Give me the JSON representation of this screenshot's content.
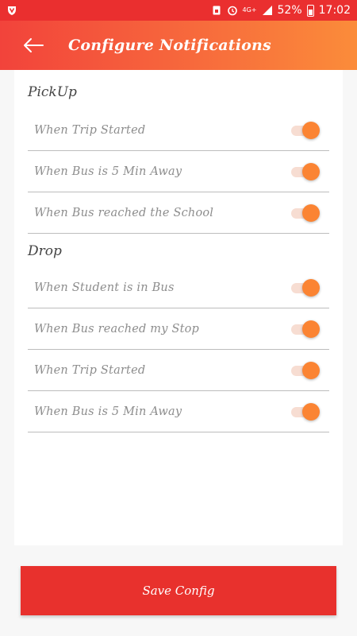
{
  "status_bar": {
    "network": "4G+",
    "battery": "52%",
    "time": "17:02"
  },
  "header": {
    "title": "Configure Notifications",
    "back_icon": "arrow-left-icon"
  },
  "sections": [
    {
      "title": "PickUp",
      "items": [
        {
          "label": "When Trip Started",
          "enabled": true
        },
        {
          "label": "When Bus is 5 Min Away",
          "enabled": true
        },
        {
          "label": "When Bus reached the School",
          "enabled": true
        }
      ]
    },
    {
      "title": "Drop",
      "items": [
        {
          "label": "When Student is in Bus",
          "enabled": true
        },
        {
          "label": "When Bus reached my Stop",
          "enabled": true
        },
        {
          "label": "When Trip Started",
          "enabled": true
        },
        {
          "label": "When Bus is 5 Min Away",
          "enabled": true
        }
      ]
    }
  ],
  "footer": {
    "save_label": "Save Config"
  },
  "colors": {
    "primary": "#e8312d",
    "accent": "#fb8433",
    "gradient_end": "#fb8c3a"
  }
}
